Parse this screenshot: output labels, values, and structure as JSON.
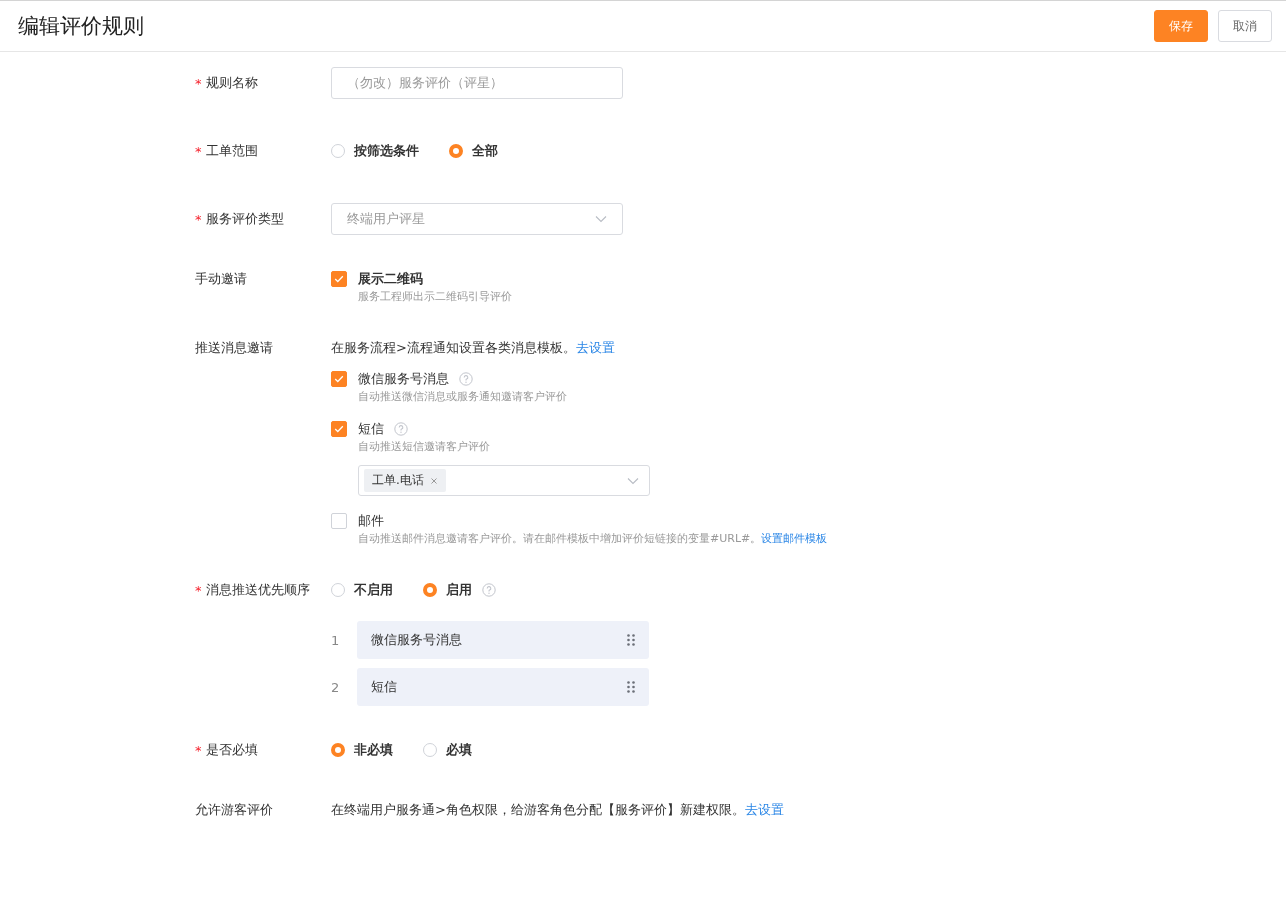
{
  "header": {
    "title": "编辑评价规则",
    "buttons": [
      {
        "label": "保存",
        "kind": "primary"
      },
      {
        "label": "取消",
        "kind": "default"
      }
    ]
  },
  "form": [
    {
      "kind": "input",
      "label": "规则名称",
      "required_mark": "*",
      "value": "（勿改）服务评价（评星）",
      "disabled": true
    },
    {
      "kind": "radio",
      "label": "工单范围",
      "required_mark": "*",
      "options": [
        {
          "label": "按筛选条件",
          "selected": false
        },
        {
          "label": "全部",
          "selected": true
        }
      ]
    },
    {
      "kind": "select",
      "label": "服务评价类型",
      "required_mark": "*",
      "value": "终端用户评星",
      "disabled": true
    },
    {
      "kind": "checks",
      "label": "手动邀请",
      "items": [
        {
          "label": "展示二维码",
          "hint": "服务工程师出示二维码引导评价",
          "checked": true,
          "bold": true
        }
      ]
    },
    {
      "kind": "checks",
      "label": "推送消息邀请",
      "note": {
        "text": "在服务流程>流程通知设置各类消息模板。",
        "link": "去设置"
      },
      "items": [
        {
          "label": "微信服务号消息",
          "hint": "自动推送微信消息或服务通知邀请客户评价",
          "checked": true,
          "bold": false,
          "help": true
        },
        {
          "label": "短信",
          "hint": "自动推送短信邀请客户评价",
          "checked": true,
          "bold": false,
          "help": true,
          "tags": [
            "工单.电话"
          ]
        },
        {
          "label": "邮件",
          "hint": "自动推送邮件消息邀请客户评价。请在邮件模板中增加评价短链接的变量#URL#。",
          "hint_link": "设置邮件模板",
          "checked": false,
          "bold": false
        }
      ]
    },
    {
      "kind": "radio",
      "label": "消息推送优先顺序",
      "required_mark": "*",
      "options": [
        {
          "label": "不启用",
          "selected": false
        },
        {
          "label": "启用",
          "selected": true,
          "help": true
        }
      ],
      "order": [
        {
          "index": "1",
          "label": "微信服务号消息"
        },
        {
          "index": "2",
          "label": "短信"
        }
      ]
    },
    {
      "kind": "radio",
      "label": "是否必填",
      "required_mark": "*",
      "options": [
        {
          "label": "非必填",
          "selected": true
        },
        {
          "label": "必填",
          "selected": false
        }
      ]
    },
    {
      "kind": "note",
      "label": "允许游客评价",
      "note": {
        "text": "在终端用户服务通>角色权限，给游客角色分配【服务评价】新建权限。",
        "link": "去设置"
      }
    }
  ]
}
